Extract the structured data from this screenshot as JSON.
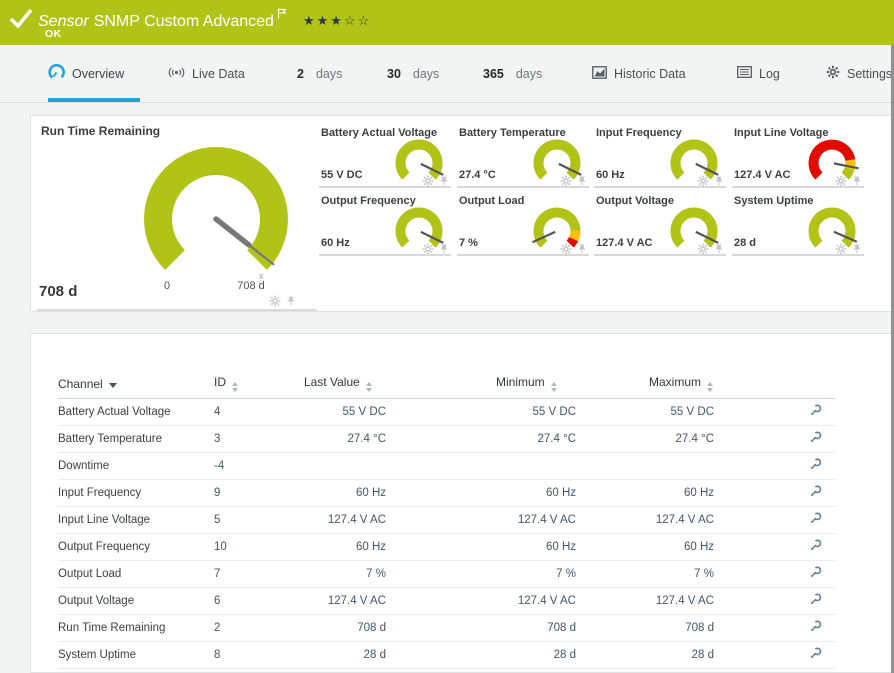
{
  "header": {
    "kind": "Sensor",
    "title": "SNMP Custom Advanced",
    "status": "OK",
    "stars": "★★★☆☆"
  },
  "tabs": [
    {
      "label": "Overview",
      "active": true
    },
    {
      "label": "Live Data"
    },
    {
      "num": "2",
      "label": "days"
    },
    {
      "num": "30",
      "label": "days"
    },
    {
      "num": "365",
      "label": "days"
    },
    {
      "label": "Historic Data"
    },
    {
      "label": "Log"
    },
    {
      "label": "Settings"
    }
  ],
  "gauge_panel": {
    "primary": {
      "title": "Run Time Remaining",
      "value": "708 d",
      "scale_start": "0",
      "scale_end": "708 d",
      "needle": 0.975,
      "segments": [
        {
          "color": "green",
          "from": 0,
          "to": 1
        }
      ]
    },
    "cells": [
      {
        "title": "Battery Actual Voltage",
        "value": "55 V DC",
        "needle": 0.93,
        "segments": [
          {
            "color": "green",
            "from": 0,
            "to": 1
          }
        ]
      },
      {
        "title": "Battery Temperature",
        "value": "27.4 °C",
        "needle": 0.93,
        "segments": [
          {
            "color": "green",
            "from": 0,
            "to": 1
          }
        ]
      },
      {
        "title": "Input Frequency",
        "value": "60 Hz",
        "needle": 0.93,
        "segments": [
          {
            "color": "green",
            "from": 0,
            "to": 1
          }
        ]
      },
      {
        "title": "Input Line Voltage",
        "value": "127.4 V AC",
        "needle": 0.875,
        "segments": [
          {
            "color": "red",
            "from": 0,
            "to": 0.8
          },
          {
            "color": "yellow",
            "from": 0.8,
            "to": 0.9
          },
          {
            "color": "green",
            "from": 0.9,
            "to": 1
          }
        ]
      },
      {
        "title": "Output Frequency",
        "value": "60 Hz",
        "needle": 0.93,
        "segments": [
          {
            "color": "green",
            "from": 0,
            "to": 1
          }
        ]
      },
      {
        "title": "Output Load",
        "value": "7 %",
        "needle": 0.075,
        "segments": [
          {
            "color": "green",
            "from": 0,
            "to": 0.83
          },
          {
            "color": "yellow",
            "from": 0.83,
            "to": 0.93
          },
          {
            "color": "red",
            "from": 0.93,
            "to": 1
          }
        ]
      },
      {
        "title": "Output Voltage",
        "value": "127.4 V AC",
        "needle": 0.93,
        "segments": [
          {
            "color": "green",
            "from": 0,
            "to": 1
          }
        ]
      },
      {
        "title": "System Uptime",
        "value": "28 d",
        "needle": 0.92,
        "segments": [
          {
            "color": "green",
            "from": 0,
            "to": 1
          }
        ]
      }
    ]
  },
  "table": {
    "columns": [
      {
        "label": "Channel",
        "sort": "desc"
      },
      {
        "label": "ID"
      },
      {
        "label": "Last Value"
      },
      {
        "label": "Minimum"
      },
      {
        "label": "Maximum"
      }
    ],
    "rows": [
      [
        "Battery Actual Voltage",
        "4",
        "55 V DC",
        "55 V DC",
        "55 V DC"
      ],
      [
        "Battery Temperature",
        "3",
        "27.4 °C",
        "27.4 °C",
        "27.4 °C"
      ],
      [
        "Downtime",
        "-4",
        "",
        "",
        ""
      ],
      [
        "Input Frequency",
        "9",
        "60 Hz",
        "60 Hz",
        "60 Hz"
      ],
      [
        "Input Line Voltage",
        "5",
        "127.4 V AC",
        "127.4 V AC",
        "127.4 V AC"
      ],
      [
        "Output Frequency",
        "10",
        "60 Hz",
        "60 Hz",
        "60 Hz"
      ],
      [
        "Output Load",
        "7",
        "7 %",
        "7 %",
        "7 %"
      ],
      [
        "Output Voltage",
        "6",
        "127.4 V AC",
        "127.4 V AC",
        "127.4 V AC"
      ],
      [
        "Run Time Remaining",
        "2",
        "708 d",
        "708 d",
        "708 d"
      ],
      [
        "System Uptime",
        "8",
        "28 d",
        "28 d",
        "28 d"
      ]
    ]
  },
  "colors": {
    "green": "#b2c318",
    "red": "#e10b00",
    "yellow": "#fdc006",
    "accent": "#24a3d9"
  }
}
